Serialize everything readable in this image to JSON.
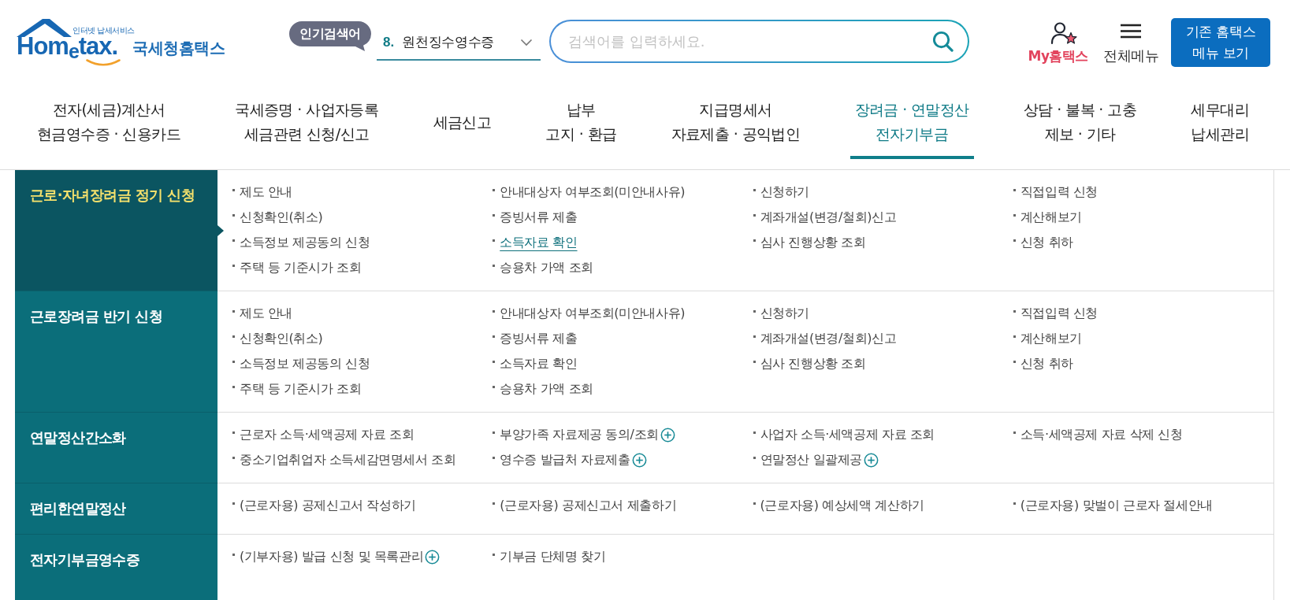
{
  "logo": {
    "tagline": "인터넷 납세서비스",
    "wordmark": "Hom$_{e}$tax.",
    "name": "국세청홈택스"
  },
  "popular_search": {
    "badge": "인기검색어",
    "rank": "8.",
    "term": "원천징수영수증"
  },
  "search": {
    "placeholder": "검색어를 입력하세요."
  },
  "header_links": [
    {
      "kind": "my",
      "label": "My홈택스"
    },
    {
      "kind": "menu",
      "label": "전체메뉴"
    }
  ],
  "legacy_button": {
    "label": "기존 홈택스 메뉴 보기"
  },
  "nav": [
    {
      "lines": [
        "전자(세금)계산서",
        "현금영수증 · 신용카드"
      ],
      "selected": false
    },
    {
      "lines": [
        "국세증명 · 사업자등록",
        "세금관련 신청/신고"
      ],
      "selected": false
    },
    {
      "lines": [
        "세금신고"
      ],
      "selected": false
    },
    {
      "lines": [
        "납부",
        "고지 · 환급"
      ],
      "selected": false
    },
    {
      "lines": [
        "지급명세서",
        "자료제출 · 공익법인"
      ],
      "selected": false
    },
    {
      "lines": [
        "장려금 · 연말정산",
        "전자기부금"
      ],
      "selected": true
    },
    {
      "lines": [
        "상담 · 불복 · 고충",
        "제보 · 기타"
      ],
      "selected": false
    },
    {
      "lines": [
        "세무대리",
        "납세관리"
      ],
      "selected": false
    }
  ],
  "menu_panel": {
    "sections": [
      {
        "title": "근로·자녀장려금 정기 신청",
        "selected": true,
        "columns": [
          [
            {
              "label": "제도 안내",
              "kind": "link",
              "highlighted": false
            },
            {
              "label": "신청확인(취소)",
              "kind": "link",
              "highlighted": false
            },
            {
              "label": "소득정보 제공동의 신청",
              "kind": "link",
              "highlighted": false
            },
            {
              "label": "주택 등 기준시가 조회",
              "kind": "link",
              "highlighted": false
            }
          ],
          [
            {
              "label": "안내대상자 여부조회(미안내사유)",
              "kind": "link",
              "highlighted": false
            },
            {
              "label": "증빙서류 제출",
              "kind": "link",
              "highlighted": false
            },
            {
              "label": "소득자료 확인",
              "kind": "link",
              "highlighted": true
            },
            {
              "label": "승용차 가액 조회",
              "kind": "link",
              "highlighted": false
            }
          ],
          [
            {
              "label": "신청하기",
              "kind": "link",
              "highlighted": false
            },
            {
              "label": "계좌개설(변경/철회)신고",
              "kind": "link",
              "highlighted": false
            },
            {
              "label": "심사 진행상황 조회",
              "kind": "link",
              "highlighted": false
            }
          ],
          [
            {
              "label": "직접입력 신청",
              "kind": "link",
              "highlighted": false
            },
            {
              "label": "계산해보기",
              "kind": "link",
              "highlighted": false
            },
            {
              "label": "신청 취하",
              "kind": "link",
              "highlighted": false
            }
          ]
        ]
      },
      {
        "title": "근로장려금 반기 신청",
        "selected": false,
        "columns": [
          [
            {
              "label": "제도 안내",
              "kind": "link",
              "highlighted": false
            },
            {
              "label": "신청확인(취소)",
              "kind": "link",
              "highlighted": false
            },
            {
              "label": "소득정보 제공동의 신청",
              "kind": "link",
              "highlighted": false
            },
            {
              "label": "주택 등 기준시가 조회",
              "kind": "link",
              "highlighted": false
            }
          ],
          [
            {
              "label": "안내대상자 여부조회(미안내사유)",
              "kind": "link",
              "highlighted": false
            },
            {
              "label": "증빙서류 제출",
              "kind": "link",
              "highlighted": false
            },
            {
              "label": "소득자료 확인",
              "kind": "link",
              "highlighted": false
            },
            {
              "label": "승용차 가액 조회",
              "kind": "link",
              "highlighted": false
            }
          ],
          [
            {
              "label": "신청하기",
              "kind": "link",
              "highlighted": false
            },
            {
              "label": "계좌개설(변경/철회)신고",
              "kind": "link",
              "highlighted": false
            },
            {
              "label": "심사 진행상황 조회",
              "kind": "link",
              "highlighted": false
            }
          ],
          [
            {
              "label": "직접입력 신청",
              "kind": "link",
              "highlighted": false
            },
            {
              "label": "계산해보기",
              "kind": "link",
              "highlighted": false
            },
            {
              "label": "신청 취하",
              "kind": "link",
              "highlighted": false
            }
          ]
        ]
      },
      {
        "title": "연말정산간소화",
        "selected": false,
        "columns": [
          [
            {
              "label": "근로자 소득·세액공제 자료 조회",
              "kind": "link",
              "highlighted": false
            },
            {
              "label": "중소기업취업자 소득세감면명세서 조회",
              "kind": "link",
              "highlighted": false
            }
          ],
          [
            {
              "label": "부양가족 자료제공 동의/조회",
              "kind": "more",
              "highlighted": false
            },
            {
              "label": "영수증 발급처 자료제출",
              "kind": "more",
              "highlighted": false
            }
          ],
          [
            {
              "label": "사업자 소득·세액공제 자료 조회",
              "kind": "link",
              "highlighted": false
            },
            {
              "label": "연말정산 일괄제공",
              "kind": "more",
              "highlighted": false
            }
          ],
          [
            {
              "label": "소득·세액공제 자료 삭제 신청",
              "kind": "link",
              "highlighted": false
            }
          ]
        ]
      },
      {
        "title": "편리한연말정산",
        "selected": false,
        "columns": [
          [
            {
              "label": "(근로자용) 공제신고서 작성하기",
              "kind": "link",
              "highlighted": false
            }
          ],
          [
            {
              "label": "(근로자용) 공제신고서 제출하기",
              "kind": "link",
              "highlighted": false
            }
          ],
          [
            {
              "label": "(근로자용) 예상세액 계산하기",
              "kind": "link",
              "highlighted": false
            }
          ],
          [
            {
              "label": "(근로자용) 맞벌이 근로자 절세안내",
              "kind": "link",
              "highlighted": false
            }
          ]
        ]
      },
      {
        "title": "전자기부금영수증",
        "selected": false,
        "columns": [
          [
            {
              "label": "(기부자용) 발급 신청 및 목록관리",
              "kind": "more",
              "highlighted": false
            }
          ],
          [
            {
              "label": "기부금 단체명 찾기",
              "kind": "link",
              "highlighted": false
            }
          ]
        ]
      }
    ]
  }
}
